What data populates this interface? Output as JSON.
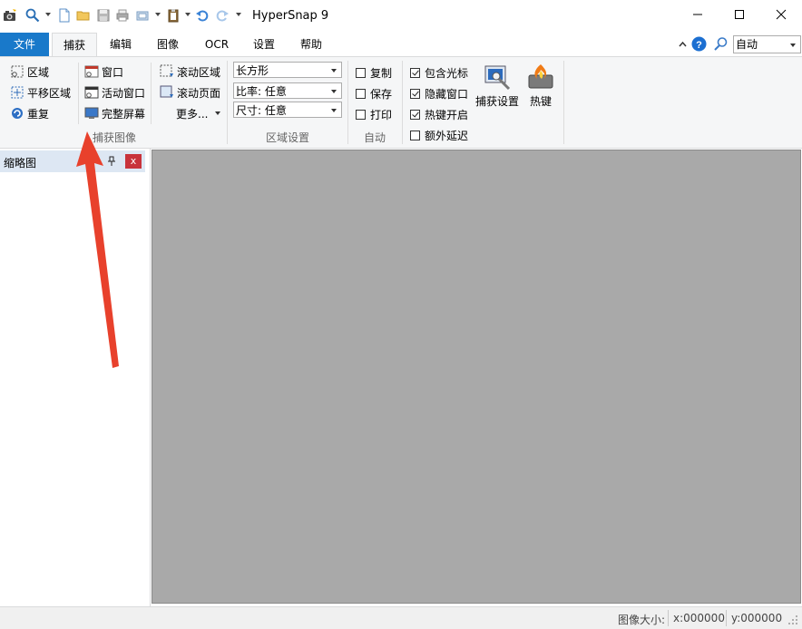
{
  "app": {
    "title": "HyperSnap 9"
  },
  "quick_access": {
    "icons": [
      "camera-icon",
      "zoom-icon",
      "new-file-icon",
      "open-folder-icon",
      "save-icon",
      "print-icon",
      "scan-icon",
      "paste-icon",
      "undo-icon",
      "redo-icon"
    ]
  },
  "window": {
    "minimize": "—",
    "maximize": "☐",
    "close": "✕"
  },
  "tabs": {
    "file": "文件",
    "capture": "捕获",
    "edit": "编辑",
    "image": "图像",
    "ocr": "OCR",
    "settings": "设置",
    "help": "帮助"
  },
  "tab_right": {
    "zoom_value": "自动"
  },
  "ribbon": {
    "capture_image": {
      "region": "区域",
      "pan_region": "平移区域",
      "repeat": "重复",
      "window": "窗口",
      "active_window": "活动窗口",
      "full_screen": "完整屏幕",
      "scroll_region": "滚动区域",
      "scroll_page": "滚动页面",
      "more": "更多...",
      "label": "捕获图像"
    },
    "region_settings": {
      "shape": "长方形",
      "ratio": "比率: 任意",
      "size": "尺寸: 任意",
      "label": "区域设置"
    },
    "auto": {
      "copy": "复制",
      "save": "保存",
      "print": "打印",
      "label": "自动"
    },
    "options": {
      "include_cursor": "包含光标",
      "hide_window": "隐藏窗口",
      "hotkey_enable": "热键开启",
      "extra_delay": "额外延迟",
      "include_cursor_checked": true,
      "hide_window_checked": true,
      "hotkey_enable_checked": true,
      "extra_delay_checked": false
    },
    "capture_settings": "捕获设置",
    "hotkeys": "热键"
  },
  "thumbnail_pane": {
    "title": "缩略图",
    "pin": "📌",
    "close": "x"
  },
  "status": {
    "image_size_label": "图像大小:",
    "x": "x:000000",
    "y": "y:000000"
  },
  "annotation": {
    "arrow_color": "#e8412c"
  }
}
